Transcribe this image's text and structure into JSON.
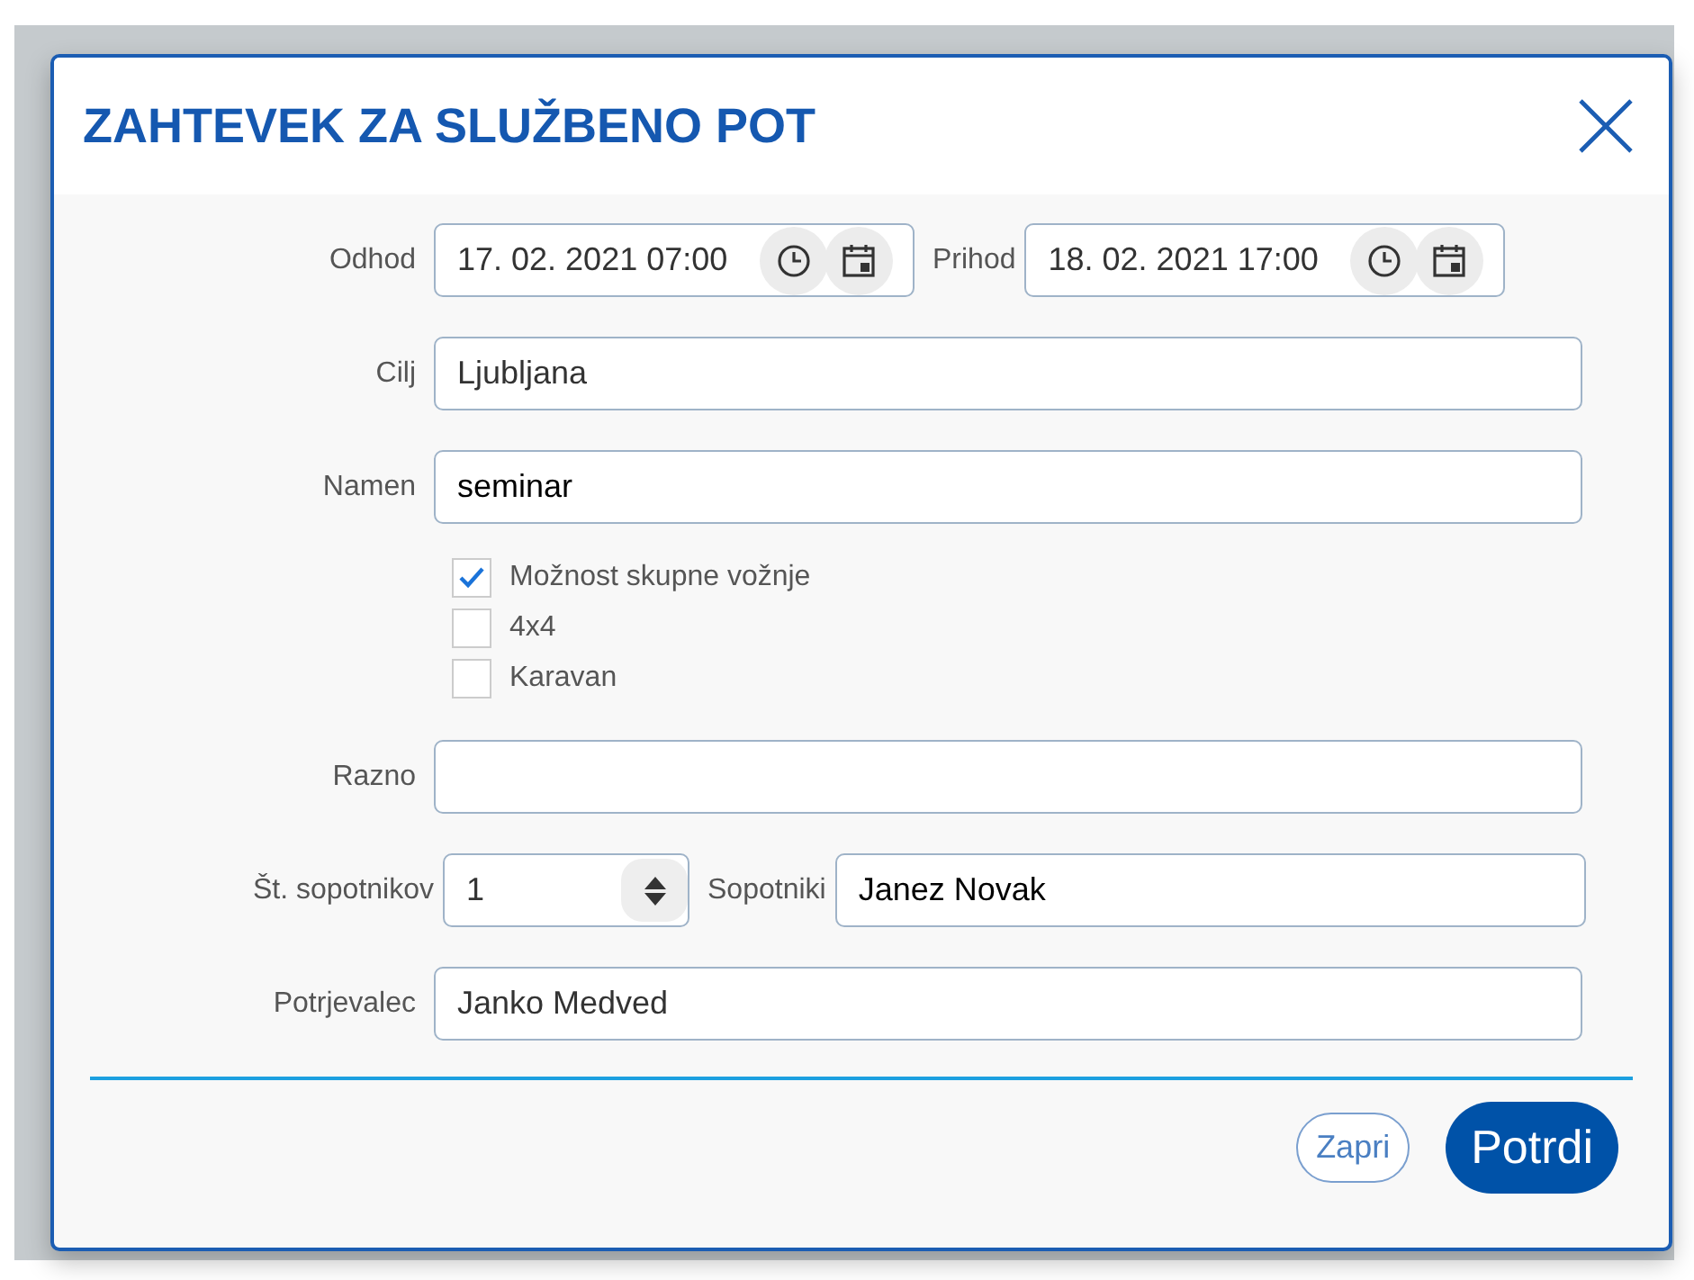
{
  "dialog": {
    "title": "ZAHTEVEK ZA SLUŽBENO POT"
  },
  "rows": [
    {
      "kind": "datetime",
      "fields": [
        {
          "label": "Odhod",
          "value": "17. 02. 2021 07:00"
        },
        {
          "label": "Prihod",
          "value": "18. 02. 2021 17:00"
        }
      ]
    },
    {
      "kind": "text",
      "label": "Cilj",
      "value": "Ljubljana"
    },
    {
      "kind": "text",
      "label": "Namen",
      "value": "seminar"
    },
    {
      "kind": "checkboxes",
      "items": [
        {
          "label": "Možnost skupne vožnje",
          "checked": true
        },
        {
          "label": "4x4",
          "checked": false
        },
        {
          "label": "Karavan",
          "checked": false
        }
      ]
    },
    {
      "kind": "text",
      "label": "Razno"
    },
    {
      "kind": "number-text",
      "fields": [
        {
          "label": "Št. sopotnikov",
          "value": "1"
        },
        {
          "label": "Sopotniki",
          "value": "Janez Novak"
        }
      ]
    },
    {
      "kind": "text",
      "label": "Potrjevalec",
      "value": "Janko Medved"
    }
  ],
  "buttons": [
    {
      "label": "Zapri",
      "kind": "secondary"
    },
    {
      "label": "Potrdi",
      "kind": "primary"
    }
  ]
}
